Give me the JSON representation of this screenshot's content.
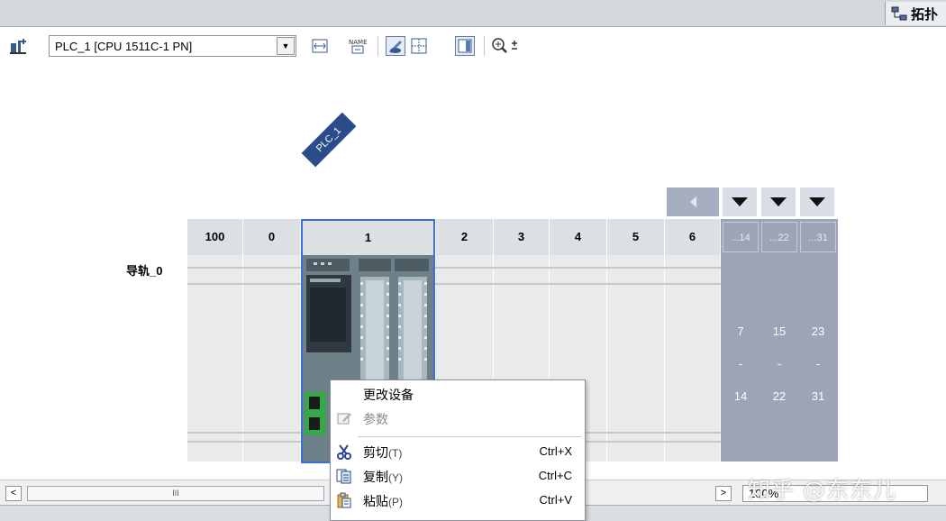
{
  "topbar": {
    "tab_label": "拓扑"
  },
  "toolbar": {
    "device_selector": "PLC_1 [CPU 1511C-1 PN]",
    "zoom_glyph": "🔍±"
  },
  "device": {
    "tag": "PLC_1"
  },
  "rack": {
    "rail_label": "导轨_0",
    "slots": [
      "100",
      "0",
      "1",
      "2",
      "3",
      "4",
      "5",
      "6"
    ],
    "expansion_heads": [
      "...14",
      "...22",
      "...31"
    ],
    "expansion_cols": [
      {
        "from": "7",
        "dash": "-",
        "to": "14"
      },
      {
        "from": "15",
        "dash": "-",
        "to": "22"
      },
      {
        "from": "23",
        "dash": "-",
        "to": "31"
      }
    ]
  },
  "context_menu": {
    "items": [
      {
        "label": "更改设备",
        "accel": "",
        "shortcut": ""
      },
      {
        "label": "参数",
        "accel": "",
        "shortcut": ""
      },
      {
        "label": "剪切",
        "accel": "(T)",
        "shortcut": "Ctrl+X"
      },
      {
        "label": "复制",
        "accel": "(Y)",
        "shortcut": "Ctrl+C"
      },
      {
        "label": "粘贴",
        "accel": "(P)",
        "shortcut": "Ctrl+V"
      }
    ]
  },
  "hscroll": {
    "thumb": "III",
    "left": "<",
    "right": ">"
  },
  "zoom": {
    "value": "100%"
  },
  "watermark": "知乎 @东东儿",
  "colors": {
    "accent": "#3a6fd8",
    "rack": "#dde0e3",
    "expansion": "#9ea4b7",
    "arrow": "#e02020"
  }
}
